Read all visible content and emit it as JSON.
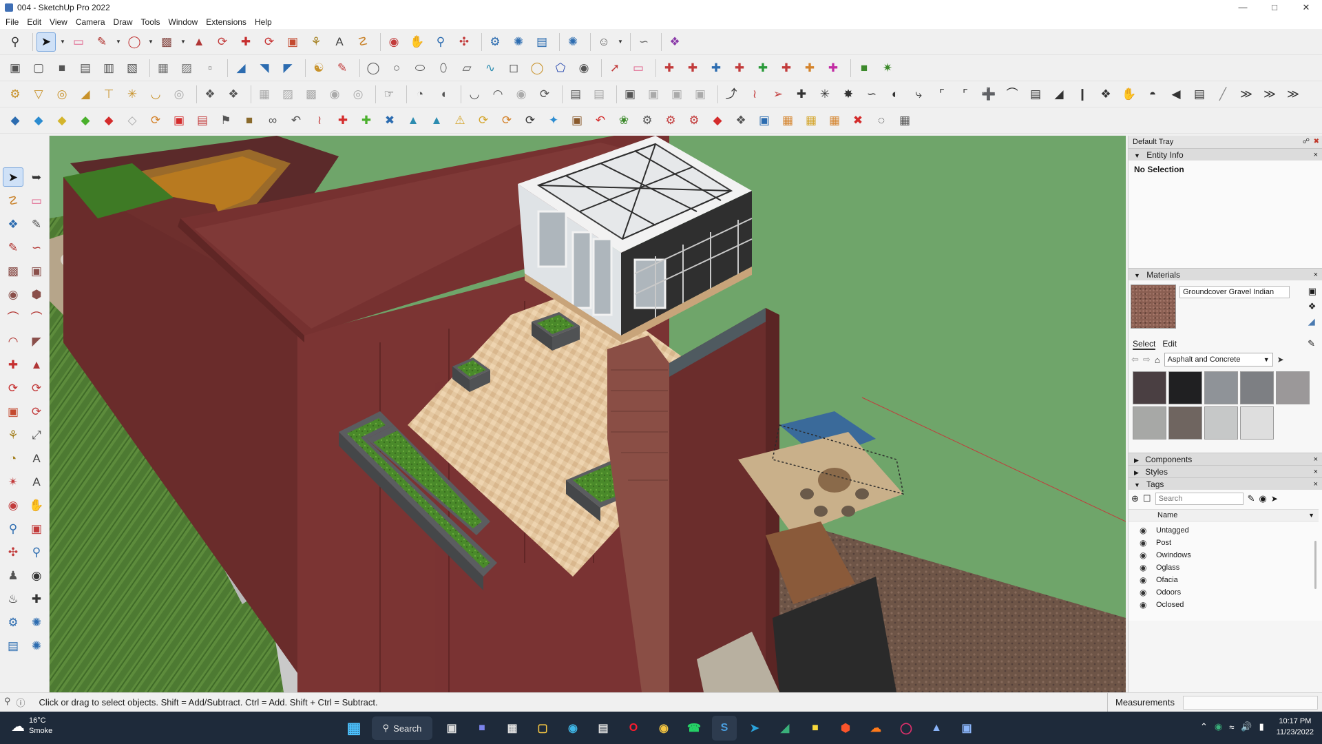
{
  "window": {
    "title": "004 - SketchUp Pro 2022"
  },
  "menu": [
    "File",
    "Edit",
    "View",
    "Camera",
    "Draw",
    "Tools",
    "Window",
    "Extensions",
    "Help"
  ],
  "tray": {
    "title": "Default Tray",
    "entity_info": {
      "label": "Entity Info",
      "selection": "No Selection"
    },
    "materials": {
      "label": "Materials",
      "current_material": "Groundcover Gravel Indian",
      "tabs": [
        "Select",
        "Edit"
      ],
      "library": "Asphalt and Concrete",
      "swatch_colors": [
        "#4a3f42",
        "#202022",
        "#8f9398",
        "#7d7f83",
        "#9b9899",
        "#a7a8a6",
        "#6f6560",
        "#c6c8c8",
        "#dedede"
      ]
    },
    "components": {
      "label": "Components"
    },
    "styles": {
      "label": "Styles"
    },
    "tags": {
      "label": "Tags",
      "search_placeholder": "Search",
      "column_name": "Name",
      "items": [
        "Untagged",
        "Post",
        "Owindows",
        "Oglass",
        "Ofacia",
        "Odoors",
        "Oclosed"
      ]
    }
  },
  "status": {
    "hint": "Click or drag to select objects. Shift = Add/Subtract. Ctrl = Add. Shift + Ctrl = Subtract.",
    "measurements_label": "Measurements"
  },
  "taskbar": {
    "weather_temp": "16°C",
    "weather_desc": "Smoke",
    "search_label": "Search",
    "time": "10:17 PM",
    "date": "11/23/2022"
  },
  "colors": {
    "viewport_green": "#6fa56a",
    "brick": "#7b3433",
    "planter_grass": "#4f8a2c",
    "accent_blue": "#3f6fb5"
  }
}
